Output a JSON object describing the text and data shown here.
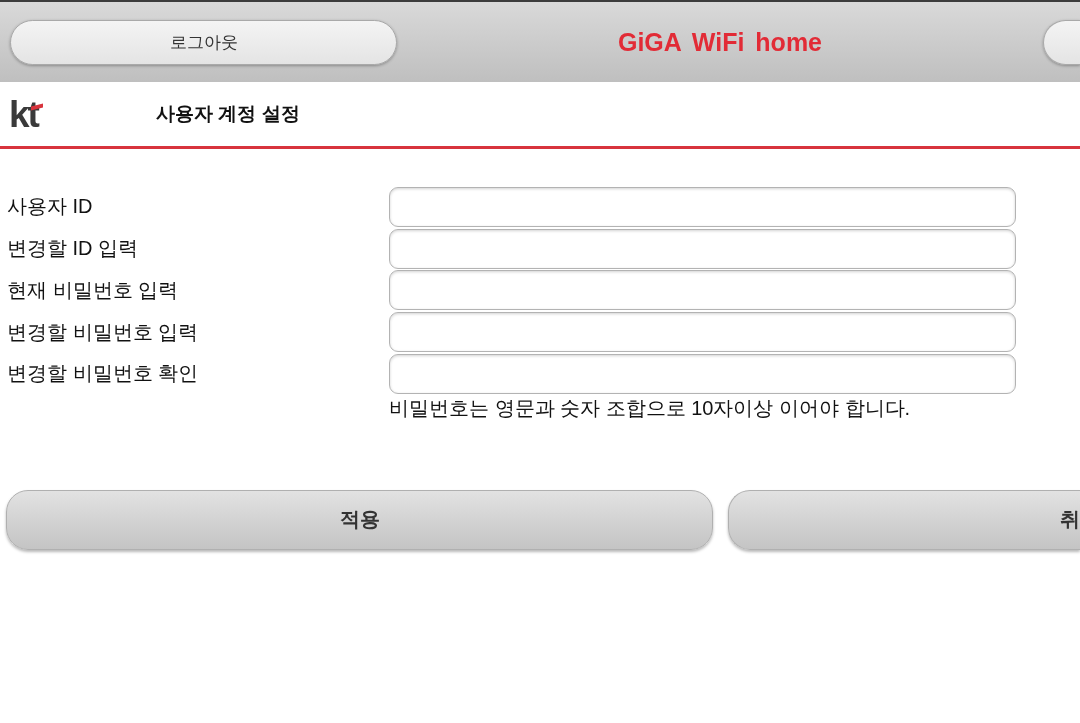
{
  "header": {
    "logout_button": "로그아웃",
    "title": "GiGA WiFi home"
  },
  "page": {
    "logo": "kt",
    "title": "사용자 계정 설정"
  },
  "form": {
    "fields": [
      {
        "label": "사용자 ID"
      },
      {
        "label": "변경할 ID 입력"
      },
      {
        "label": "현재 비밀번호 입력"
      },
      {
        "label": "변경할 비밀번호 입력"
      },
      {
        "label": "변경할 비밀번호 확인"
      }
    ],
    "hint": "비밀번호는 영문과 숫자 조합으로 10자이상 이어야 합니다."
  },
  "buttons": [
    "적용",
    "취"
  ]
}
